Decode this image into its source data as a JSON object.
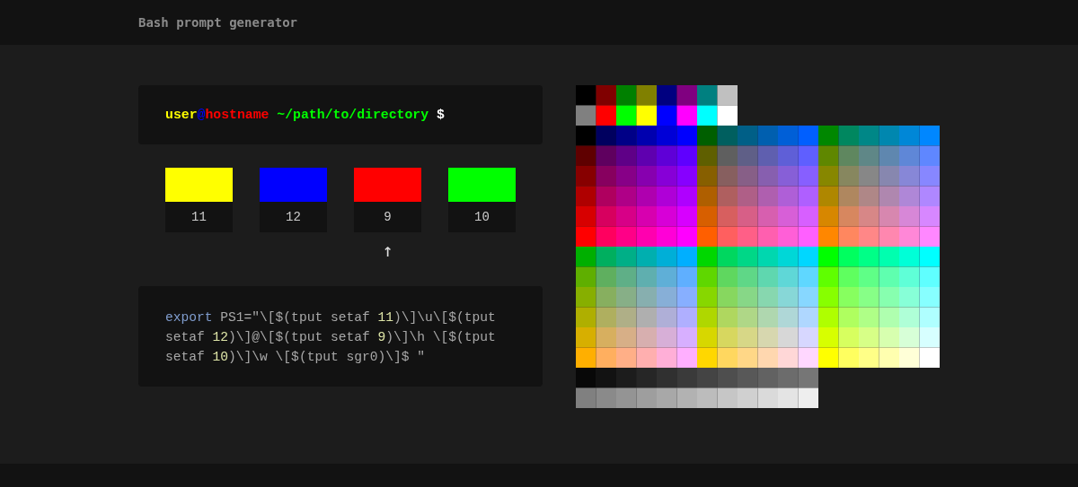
{
  "header": {
    "title": "Bash prompt generator"
  },
  "prompt_preview": [
    {
      "text": "user",
      "color": "#ffff00"
    },
    {
      "text": "@",
      "color": "#0000ff"
    },
    {
      "text": "hostname",
      "color": "#ff0000"
    },
    {
      "text": " ~/path/to/directory",
      "color": "#00ff00"
    },
    {
      "text": " $",
      "color": "#ffffff"
    }
  ],
  "swatches": [
    {
      "label": "11",
      "color": "#ffff00",
      "selected": false
    },
    {
      "label": "12",
      "color": "#0000ff",
      "selected": false
    },
    {
      "label": "9",
      "color": "#ff0000",
      "selected": true
    },
    {
      "label": "10",
      "color": "#00ff00",
      "selected": false
    }
  ],
  "pointer": "↑",
  "code": [
    {
      "kind": "keyword",
      "text": "export"
    },
    {
      "kind": "plain",
      "text": " PS1=\"\\[$(tput setaf "
    },
    {
      "kind": "number",
      "text": "11"
    },
    {
      "kind": "plain",
      "text": ")\\]\\u\\[$(tput setaf "
    },
    {
      "kind": "number",
      "text": "12"
    },
    {
      "kind": "plain",
      "text": ")\\]@\\[$(tput setaf "
    },
    {
      "kind": "number",
      "text": "9"
    },
    {
      "kind": "plain",
      "text": ")\\]\\h \\[$(tput setaf "
    },
    {
      "kind": "number",
      "text": "10"
    },
    {
      "kind": "plain",
      "text": ")\\]\\w \\[$(tput sgr0)\\]$ \""
    }
  ]
}
